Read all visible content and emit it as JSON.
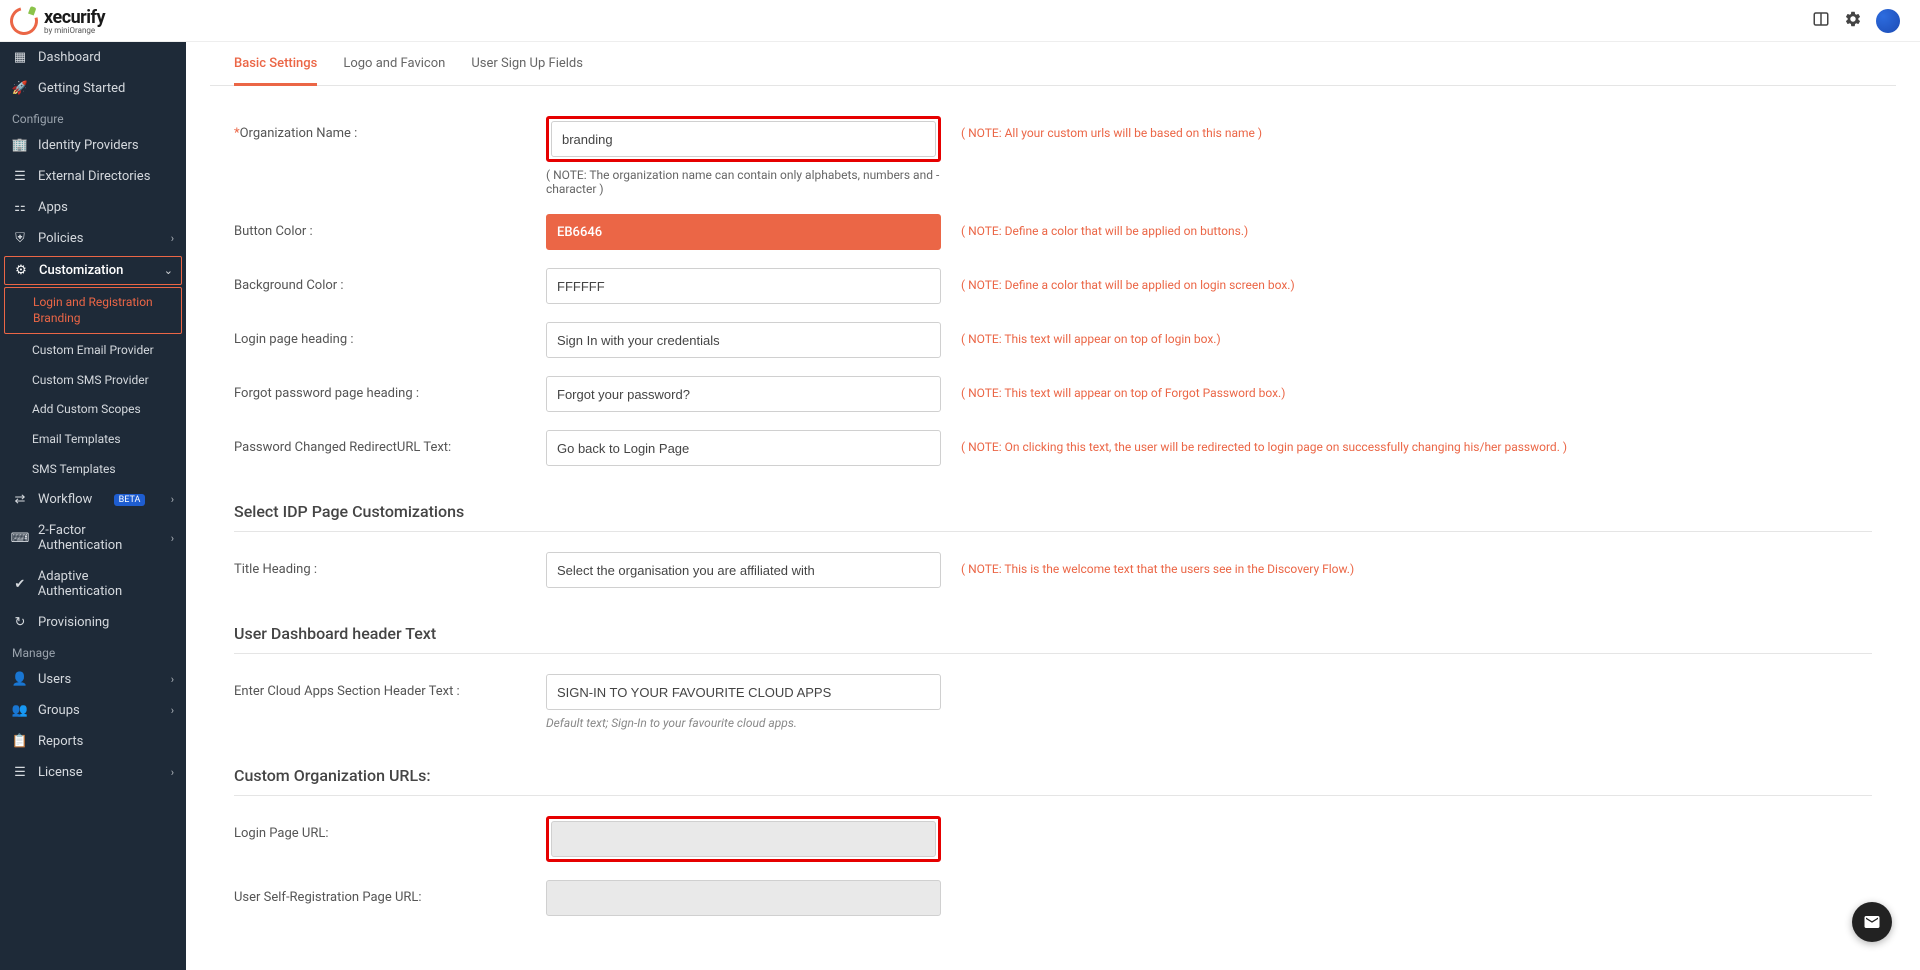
{
  "brand": {
    "name": "xecurify",
    "sub": "by miniOrange"
  },
  "header": {},
  "sidebar": {
    "items": {
      "dashboard": "Dashboard",
      "getting_started": "Getting Started",
      "identity_providers": "Identity Providers",
      "external_dirs": "External Directories",
      "apps": "Apps",
      "policies": "Policies",
      "customization": "Customization",
      "workflow": "Workflow",
      "two_factor": "2-Factor Authentication",
      "adaptive": "Adaptive Authentication",
      "provisioning": "Provisioning",
      "users": "Users",
      "groups": "Groups",
      "reports": "Reports",
      "license": "License"
    },
    "customization_sub": {
      "login_reg": "Login and Registration Branding",
      "email_provider": "Custom Email Provider",
      "sms_provider": "Custom SMS Provider",
      "custom_scopes": "Add Custom Scopes",
      "email_templates": "Email Templates",
      "sms_templates": "SMS Templates"
    },
    "sections": {
      "configure": "Configure",
      "manage": "Manage"
    },
    "badge": "BETA"
  },
  "tabs": {
    "basic": "Basic Settings",
    "logo": "Logo and Favicon",
    "signup": "User Sign Up Fields"
  },
  "form": {
    "org_name": {
      "label": "Organization Name :",
      "value": "branding",
      "note": "( NOTE: All your custom urls will be based on this name )",
      "subnote": "( NOTE: The organization name can contain only alphabets, numbers and - character )"
    },
    "button_color": {
      "label": "Button Color :",
      "value": "EB6646",
      "note": "( NOTE: Define a color that will be applied on buttons.)"
    },
    "bg_color": {
      "label": "Background Color :",
      "value": "FFFFFF",
      "note": "( NOTE: Define a color that will be applied on login screen box.)"
    },
    "login_heading": {
      "label": "Login page heading :",
      "value": "Sign In with your credentials",
      "note": "( NOTE: This text will appear on top of login box.)"
    },
    "forgot_heading": {
      "label": "Forgot password page heading :",
      "value": "Forgot your password?",
      "note": "( NOTE: This text will appear on top of Forgot Password box.)"
    },
    "pwd_redirect": {
      "label": "Password Changed RedirectURL Text:",
      "value": "Go back to Login Page",
      "note": "( NOTE: On clicking this text, the user will be redirected to login page on successfully changing his/her password. )"
    },
    "idp_section": "Select IDP Page Customizations",
    "title_heading": {
      "label": "Title Heading :",
      "value": "Select the organisation you are affiliated with",
      "note": "( NOTE: This is the welcome text that the users see in the Discovery Flow.)"
    },
    "dashboard_section": "User Dashboard header Text",
    "cloud_apps": {
      "label": "Enter Cloud Apps Section Header Text :",
      "value": "SIGN-IN TO YOUR FAVOURITE CLOUD APPS",
      "subnote": "Default text; Sign-In to your favourite cloud apps."
    },
    "urls_section": "Custom Organization URLs:",
    "login_url": {
      "label": "Login Page URL:",
      "value": ""
    },
    "self_reg_url": {
      "label": "User Self-Registration Page URL:",
      "value": ""
    }
  }
}
